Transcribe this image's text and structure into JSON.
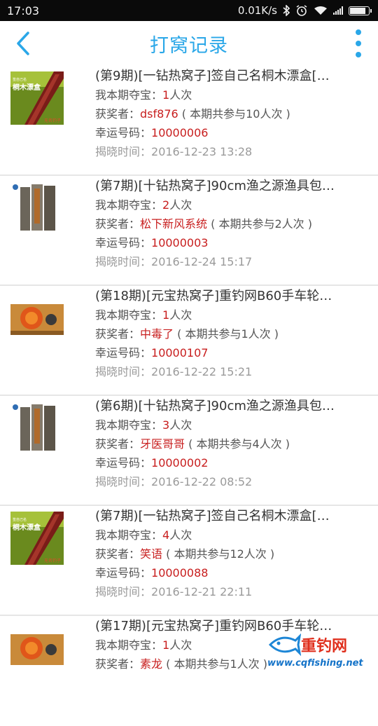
{
  "status_bar": {
    "time": "17:03",
    "speed": "0.01K/s"
  },
  "header": {
    "title": "打窝记录"
  },
  "labels": {
    "my_snatch": "我本期夺宝：",
    "winner": "获奖者：",
    "lucky_number": "幸运号码：",
    "reveal_time": "揭晓时间："
  },
  "records": [
    {
      "title": "(第9期)[一钻热窝子]签自己名桐木漂盒[…",
      "count": "1",
      "unit": "人次",
      "winner": "dsf876",
      "participants": " ( 本期共参与10人次 )",
      "lucky_number": "10000006",
      "reveal_time": "2016-12-23 13:28",
      "thumb": "float-box-red"
    },
    {
      "title": "(第7期)[十钻热窝子]90cm渔之源渔具包…",
      "count": "2",
      "unit": "人次",
      "winner": "松下新风系统",
      "participants": " ( 本期共参与2人次 )",
      "lucky_number": "10000003",
      "reveal_time": "2016-12-24 15:17",
      "thumb": "tackle-bag"
    },
    {
      "title": "(第18期)[元宝热窝子]重钓网B60手车轮…",
      "count": "1",
      "unit": "人次",
      "winner": "中毒了",
      "participants": " ( 本期共参与1人次 )",
      "lucky_number": "10000107",
      "reveal_time": "2016-12-22 15:21",
      "thumb": "reel"
    },
    {
      "title": "(第6期)[十钻热窝子]90cm渔之源渔具包…",
      "count": "3",
      "unit": "人次",
      "winner": "牙医哥哥",
      "participants": " ( 本期共参与4人次 )",
      "lucky_number": "10000002",
      "reveal_time": "2016-12-22 08:52",
      "thumb": "tackle-bag"
    },
    {
      "title": "(第7期)[一钻热窝子]签自己名桐木漂盒[…",
      "count": "4",
      "unit": "人次",
      "winner": "笑语",
      "participants": " ( 本期共参与12人次 )",
      "lucky_number": "10000088",
      "reveal_time": "2016-12-21 22:11",
      "thumb": "float-box-red"
    },
    {
      "title": "(第17期)[元宝热窝子]重钓网B60手车轮…",
      "count": "1",
      "unit": "人次",
      "winner": "素龙",
      "participants": " ( 本期共参与1人次 )",
      "lucky_number": "",
      "reveal_time": "",
      "thumb": "reel"
    }
  ],
  "thumb_text": {
    "float_box_big": "桐木漂盒",
    "float_box_small": "签自己名",
    "float_box_sign": "无名钓子"
  },
  "watermark": {
    "brand": "重钓网",
    "url": "www.cqfishing.net"
  },
  "colors": {
    "accent": "#2aa7e8",
    "winner_red": "#c81e1e"
  }
}
